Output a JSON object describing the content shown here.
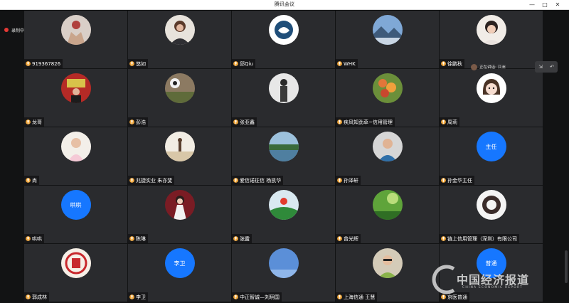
{
  "window": {
    "title": "腾讯会议"
  },
  "recording": {
    "label": "录制中"
  },
  "speaker": {
    "label": "正在讲话: 江洲"
  },
  "watermark": {
    "text": "中国经济报道",
    "sub": "CHINA ECONOMIC REPORT"
  },
  "colors": {
    "tile": "#2a2b2e",
    "text_avatar": "#1677ff",
    "record_dot": "#e53935"
  },
  "participants": [
    {
      "name": "919367826",
      "avatar": "photo-hands"
    },
    {
      "name": "悠如",
      "avatar": "photo-woman"
    },
    {
      "name": "邱Qiu",
      "avatar": "photo-logo-blue"
    },
    {
      "name": "WHK",
      "avatar": "photo-landscape"
    },
    {
      "name": "徐鹏秋",
      "avatar": "photo-girl"
    },
    {
      "name": "龙哥",
      "avatar": "photo-red-room"
    },
    {
      "name": "彭浩",
      "avatar": "photo-garden"
    },
    {
      "name": "张亚鑫",
      "avatar": "photo-person"
    },
    {
      "name": "疾风知劲草~信用管理",
      "avatar": "photo-flowers"
    },
    {
      "name": "周莉",
      "avatar": "photo-cartoon-girl"
    },
    {
      "name": "尚",
      "avatar": "photo-child"
    },
    {
      "name": "兆捷实业 朱亦斐",
      "avatar": "photo-beach"
    },
    {
      "name": "爱信诺征信 杨凯华",
      "avatar": "photo-lake"
    },
    {
      "name": "孙泽轩",
      "avatar": "photo-boy"
    },
    {
      "name": "孙金华主任",
      "avatar_text": "主任"
    },
    {
      "name": "哄哄",
      "avatar_text": "哄哄"
    },
    {
      "name": "陈琳",
      "avatar": "photo-woman-red"
    },
    {
      "name": "张露",
      "avatar": "photo-sunrise"
    },
    {
      "name": "曾光辉",
      "avatar": "photo-green"
    },
    {
      "name": "链上信用管理（深圳）有限公司",
      "avatar": "photo-company-logo"
    },
    {
      "name": "郭成林",
      "avatar": "photo-seal"
    },
    {
      "name": "李卫",
      "avatar_text": "李卫"
    },
    {
      "name": "中正智诚—刘玥国",
      "avatar": "photo-sky"
    },
    {
      "name": "上海信通 王慧",
      "avatar": "photo-boy-glasses"
    },
    {
      "name": "京医普通",
      "avatar_text": "普通"
    }
  ]
}
